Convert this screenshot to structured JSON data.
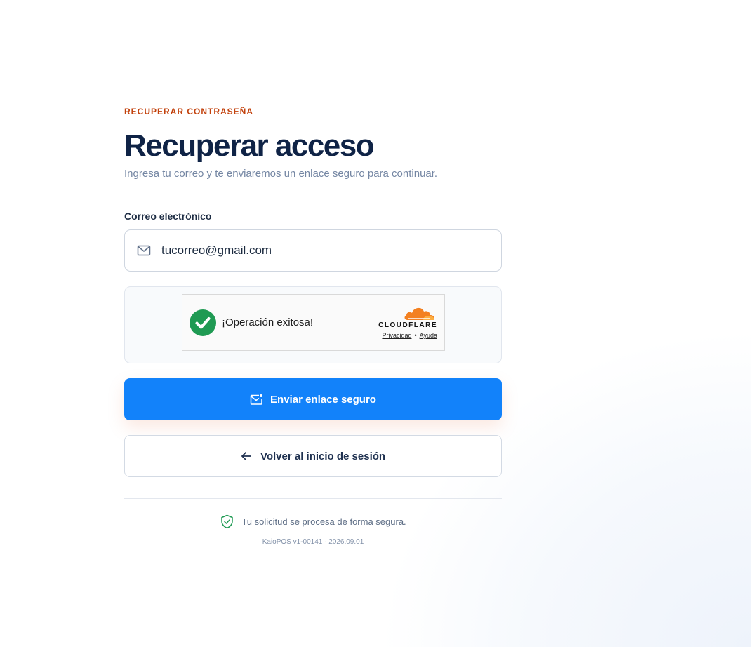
{
  "header": {
    "eyebrow": "RECUPERAR CONTRASEÑA",
    "title": "Recuperar acceso",
    "subtitle": "Ingresa tu correo y te enviaremos un enlace seguro para continuar."
  },
  "form": {
    "email_label": "Correo electrónico",
    "email_value": "tucorreo@gmail.com",
    "email_icon": "mail-icon"
  },
  "captcha": {
    "status": "¡Operación exitosa!",
    "status_icon": "check-circle-icon",
    "provider": "CLOUDFLARE",
    "privacy_link": "Privacidad",
    "separator": "•",
    "help_link": "Ayuda"
  },
  "actions": {
    "submit_label": "Enviar enlace seguro",
    "submit_icon": "mail-send-icon",
    "back_label": "Volver al inicio de sesión",
    "back_icon": "arrow-left-icon"
  },
  "footer": {
    "secure_text": "Tu solicitud se procesa de forma segura.",
    "secure_icon": "shield-check-icon",
    "version": "KaioPOS v1-00141 · 2026.09.01"
  },
  "colors": {
    "accent": "#1282fa",
    "eyebrow": "#c2410c",
    "title": "#0f2346",
    "success": "#1f9a53",
    "cloudflare": "#f38020"
  }
}
